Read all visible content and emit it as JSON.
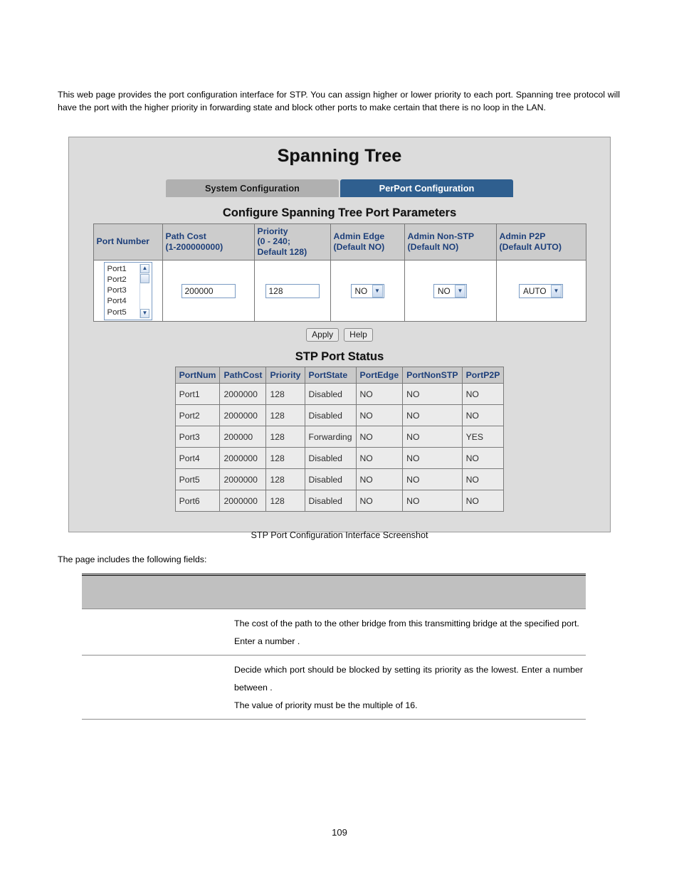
{
  "intro_paragraph": "This web page provides the port configuration interface for STP. You can assign higher or lower priority to each port. Spanning tree protocol will have the port with the higher priority in forwarding state and block other ports to make certain that there is no loop in the LAN.",
  "screenshot": {
    "title": "Spanning Tree",
    "tabs": [
      {
        "label": "System Configuration",
        "active": false
      },
      {
        "label": "PerPort Configuration",
        "active": true
      }
    ],
    "config_section": {
      "heading": "Configure Spanning Tree Port Parameters",
      "headers": [
        "Port Number",
        "Path Cost\n(1-200000000)",
        "Priority\n(0 - 240;\nDefault 128)",
        "Admin Edge\n(Default NO)",
        "Admin Non-STP\n(Default NO)",
        "Admin P2P\n(Default AUTO)"
      ],
      "port_list": {
        "options": [
          "Port1",
          "Port2",
          "Port3",
          "Port4",
          "Port5"
        ],
        "scroll_up_glyph": "▲",
        "scroll_down_glyph": "▼"
      },
      "path_cost_value": "200000",
      "priority_value": "128",
      "admin_edge_value": "NO",
      "admin_nonstp_value": "NO",
      "admin_p2p_value": "AUTO",
      "dropdown_glyph": "▼",
      "buttons": {
        "apply": "Apply",
        "help": "Help"
      }
    },
    "status_section": {
      "heading": "STP Port Status",
      "headers": [
        "PortNum",
        "PathCost",
        "Priority",
        "PortState",
        "PortEdge",
        "PortNonSTP",
        "PortP2P"
      ],
      "rows": [
        [
          "Port1",
          "2000000",
          "128",
          "Disabled",
          "NO",
          "NO",
          "NO"
        ],
        [
          "Port2",
          "2000000",
          "128",
          "Disabled",
          "NO",
          "NO",
          "NO"
        ],
        [
          "Port3",
          "200000",
          "128",
          "Forwarding",
          "NO",
          "NO",
          "YES"
        ],
        [
          "Port4",
          "2000000",
          "128",
          "Disabled",
          "NO",
          "NO",
          "NO"
        ],
        [
          "Port5",
          "2000000",
          "128",
          "Disabled",
          "NO",
          "NO",
          "NO"
        ],
        [
          "Port6",
          "2000000",
          "128",
          "Disabled",
          "NO",
          "NO",
          "NO"
        ]
      ]
    }
  },
  "figure_caption": "STP Port Configuration Interface Screenshot",
  "fields_intro": "The page includes the following fields:",
  "description_table": {
    "header_label": "",
    "rows": [
      {
        "label": "",
        "body_lines": [
          "The cost of the path to the other bridge from this transmitting bridge at the specified port.",
          "Enter a number ."
        ]
      },
      {
        "label": "",
        "body_lines": [
          "Decide which port should be blocked by setting its priority as the lowest. Enter a number between .",
          "The value of priority must be the multiple of 16."
        ]
      }
    ]
  },
  "page_number": "109"
}
